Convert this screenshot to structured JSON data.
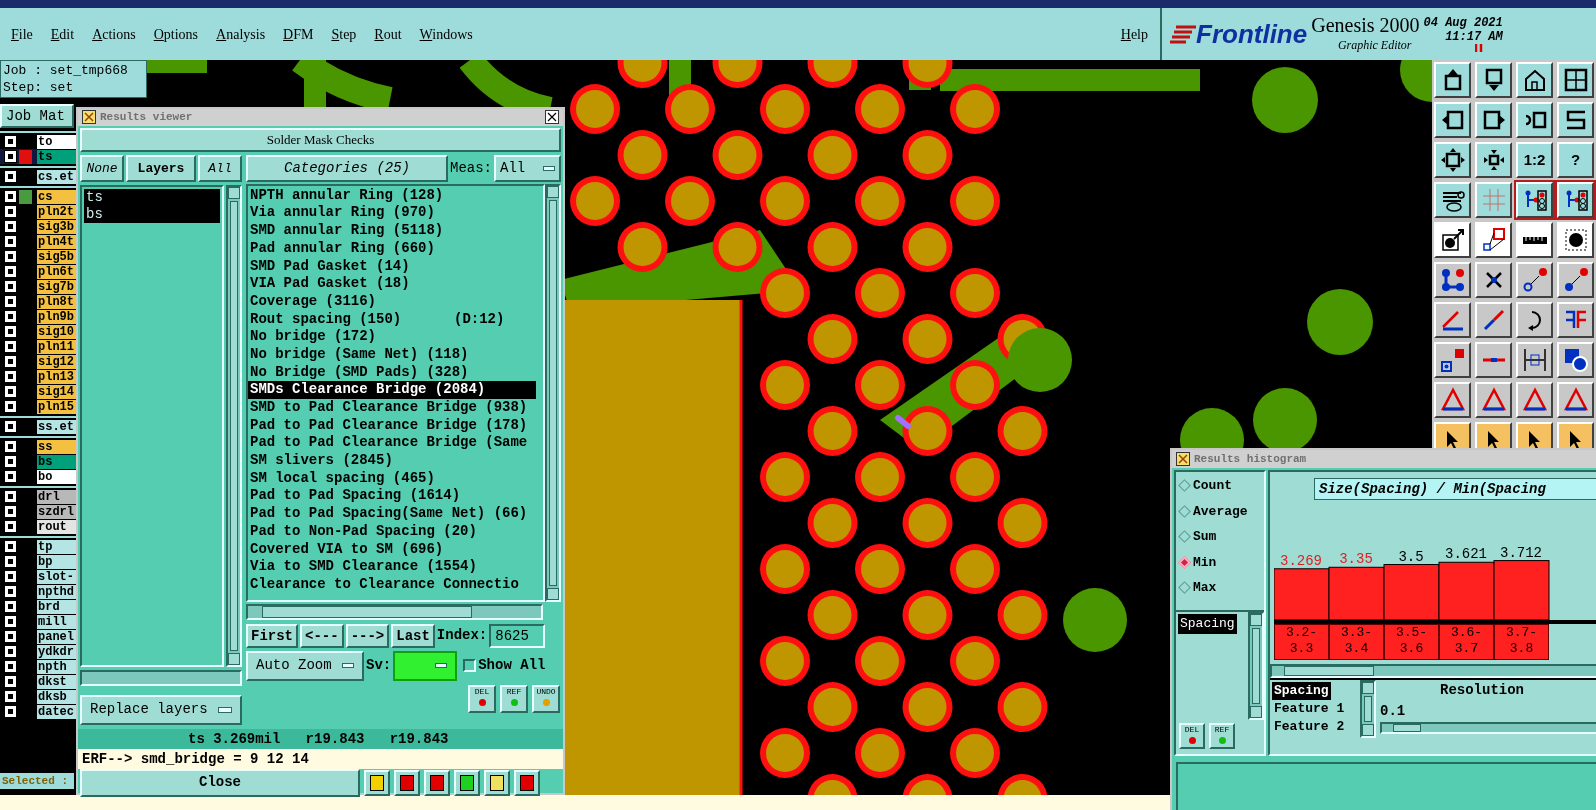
{
  "menu": {
    "items": [
      "File",
      "Edit",
      "Actions",
      "Options",
      "Analysis",
      "DFM",
      "Step",
      "Rout",
      "Windows"
    ],
    "help": "Help"
  },
  "brand": {
    "logo": "Frontline",
    "product": "Genesis 2000",
    "subtitle": "Graphic Editor",
    "date": "04 Aug 2021",
    "time": "11:17 AM"
  },
  "job_panel": {
    "job": "Job : set_tmp668",
    "step": "Step: set",
    "matrix_button": "Job Mat",
    "selected_label": "Selected :",
    "layer_groups": [
      [
        {
          "name": "to",
          "color": "#ffffff",
          "selected": false
        },
        {
          "name": "ts",
          "color": "#00a07a",
          "selected": true,
          "swatch": {
            "color": "#e01010"
          }
        }
      ],
      [
        {
          "name": "cs.et",
          "color": "#b4e4e4",
          "selected": false
        }
      ],
      [
        {
          "name": "cs",
          "color": "#f4c040",
          "selected": false,
          "swatch": {
            "color": "#4a9a40"
          }
        },
        {
          "name": "pln2t",
          "color": "#f4c040",
          "selected": false
        },
        {
          "name": "sig3b",
          "color": "#f4c040",
          "selected": false
        },
        {
          "name": "pln4t",
          "color": "#f4c040",
          "selected": false
        },
        {
          "name": "sig5b",
          "color": "#f4c040",
          "selected": false
        },
        {
          "name": "pln6t",
          "color": "#f4c040",
          "selected": false
        },
        {
          "name": "sig7b",
          "color": "#f4c040",
          "selected": false
        },
        {
          "name": "pln8t",
          "color": "#f4c040",
          "selected": false
        },
        {
          "name": "pln9b",
          "color": "#f4c040",
          "selected": false
        },
        {
          "name": "sig10",
          "color": "#f4c040",
          "selected": false
        },
        {
          "name": "pln11",
          "color": "#f4c040",
          "selected": false
        },
        {
          "name": "sig12",
          "color": "#f4c040",
          "selected": false
        },
        {
          "name": "pln13",
          "color": "#f4c040",
          "selected": false
        },
        {
          "name": "sig14",
          "color": "#f4c040",
          "selected": false
        },
        {
          "name": "pln15",
          "color": "#f4c040",
          "selected": false
        }
      ],
      [
        {
          "name": "ss.et",
          "color": "#b4e4e4",
          "selected": false
        }
      ],
      [
        {
          "name": "ss",
          "color": "#f4c040",
          "selected": false
        },
        {
          "name": "bs",
          "color": "#00a07a",
          "selected": false
        },
        {
          "name": "bo",
          "color": "#ffffff",
          "selected": false
        }
      ],
      [
        {
          "name": "drl",
          "color": "#b8b8b8",
          "selected": false
        },
        {
          "name": "szdrl",
          "color": "#b8b8b8",
          "selected": false
        },
        {
          "name": "rout",
          "color": "#e4e4e4",
          "selected": false
        }
      ],
      [
        {
          "name": "tp",
          "color": "#b4e4e4",
          "selected": false
        },
        {
          "name": "bp",
          "color": "#b4e4e4",
          "selected": false
        },
        {
          "name": "slot-",
          "color": "#b4e4e4",
          "selected": false
        },
        {
          "name": "npthd",
          "color": "#b4e4e4",
          "selected": false
        },
        {
          "name": "brd",
          "color": "#b4e4e4",
          "selected": false
        },
        {
          "name": "mill",
          "color": "#b4e4e4",
          "selected": false
        },
        {
          "name": "panel",
          "color": "#b4e4e4",
          "selected": false
        },
        {
          "name": "ydkdr",
          "color": "#b4e4e4",
          "selected": false
        },
        {
          "name": "npth",
          "color": "#b4e4e4",
          "selected": false
        },
        {
          "name": "dkst",
          "color": "#b4e4e4",
          "selected": false
        },
        {
          "name": "dksb",
          "color": "#b4e4e4",
          "selected": false
        },
        {
          "name": "datec",
          "color": "#b4e4e4",
          "selected": false
        }
      ]
    ]
  },
  "toolbar": {
    "text_buttons": [
      "1:2",
      "?"
    ]
  },
  "results_viewer": {
    "title": "Results viewer",
    "header": "Solder Mask Checks",
    "layer_buttons": [
      "None",
      "Layers",
      "All"
    ],
    "layers": [
      {
        "name": "ts",
        "selected": true
      },
      {
        "name": "bs",
        "selected": true
      }
    ],
    "replace": "Replace layers",
    "categories_button": "Categories (25)",
    "meas_label": "Meas:",
    "meas_value": "All",
    "categories": [
      {
        "label": "NPTH annular Ring (128)",
        "selected": false
      },
      {
        "label": "Via annular Ring (970)",
        "selected": false
      },
      {
        "label": "SMD annular Ring (5118)",
        "selected": false
      },
      {
        "label": "Pad annular Ring (660)",
        "selected": false
      },
      {
        "label": "SMD Pad Gasket (14)",
        "selected": false
      },
      {
        "label": "VIA Pad Gasket (18)",
        "selected": false
      },
      {
        "label": "Coverage (3116)",
        "selected": false
      },
      {
        "label": "Rout spacing (150)",
        "selected": false,
        "note": "(D:12)"
      },
      {
        "label": "No bridge (172)",
        "selected": false
      },
      {
        "label": "No bridge (Same Net) (118)",
        "selected": false
      },
      {
        "label": "No Bridge (SMD Pads) (328)",
        "selected": false
      },
      {
        "label": "SMDs Clearance Bridge (2084)",
        "selected": true
      },
      {
        "label": "SMD to Pad Clearance Bridge (938)",
        "selected": false
      },
      {
        "label": "Pad to Pad Clearance Bridge (178)",
        "selected": false
      },
      {
        "label": "Pad to Pad Clearance Bridge (Same",
        "selected": false
      },
      {
        "label": "SM slivers (2845)",
        "selected": false
      },
      {
        "label": "SM local spacing (465)",
        "selected": false
      },
      {
        "label": "Pad to Pad Spacing (1614)",
        "selected": false
      },
      {
        "label": "Pad to Pad Spacing(Same Net) (66)",
        "selected": false
      },
      {
        "label": "Pad to Non-Pad Spacing (20)",
        "selected": false
      },
      {
        "label": "Covered VIA to SM (696)",
        "selected": false
      },
      {
        "label": "Via to SMD Clearance (1554)",
        "selected": false
      },
      {
        "label": "Clearance to Clearance Connectio",
        "selected": false
      }
    ],
    "nav": [
      "First",
      "<---",
      "--->",
      "Last"
    ],
    "index_label": "Index:",
    "index_value": "8625",
    "zoom_mode": "Auto Zoom",
    "sv_label": "Sv:",
    "show_all": {
      "label": "Show All",
      "checked": false
    },
    "edit_buttons": [
      "DEL",
      "REF",
      "UNDO"
    ],
    "status": "ts 3.269mil   r19.843   r19.843",
    "erf": "ERF--> smd_bridge = 9 12 14",
    "close": "Close"
  },
  "histogram": {
    "title": "Results histogram",
    "modes": [
      {
        "label": "Count",
        "selected": false
      },
      {
        "label": "Average",
        "selected": false
      },
      {
        "label": "Sum",
        "selected": false
      },
      {
        "label": "Min",
        "selected": true
      },
      {
        "label": "Max",
        "selected": false
      }
    ],
    "fields": [
      {
        "label": "Spacing",
        "selected": true
      }
    ],
    "edit_buttons": [
      "DEL",
      "REF"
    ],
    "chart_title": "Size(Spacing) / Min(Spacing",
    "chart_data": {
      "type": "bar",
      "categories": [
        "3.2-3.3",
        "3.3-3.4",
        "3.5-3.6",
        "3.6-3.7",
        "3.7-3.8"
      ],
      "series": [
        {
          "color": "#ff2020",
          "values": [
            3.269,
            3.35,
            3.5,
            3.621,
            3.712
          ]
        }
      ],
      "data_labels": true
    },
    "flagged_bars": [
      true,
      true,
      false,
      false,
      false
    ],
    "features": [
      {
        "label": "Spacing",
        "selected": true
      },
      {
        "label": "Feature 1",
        "selected": false
      },
      {
        "label": "Feature 2",
        "selected": false
      }
    ],
    "resolution": {
      "label": "Resolution",
      "value": "0.1",
      "level": 0.05
    }
  }
}
